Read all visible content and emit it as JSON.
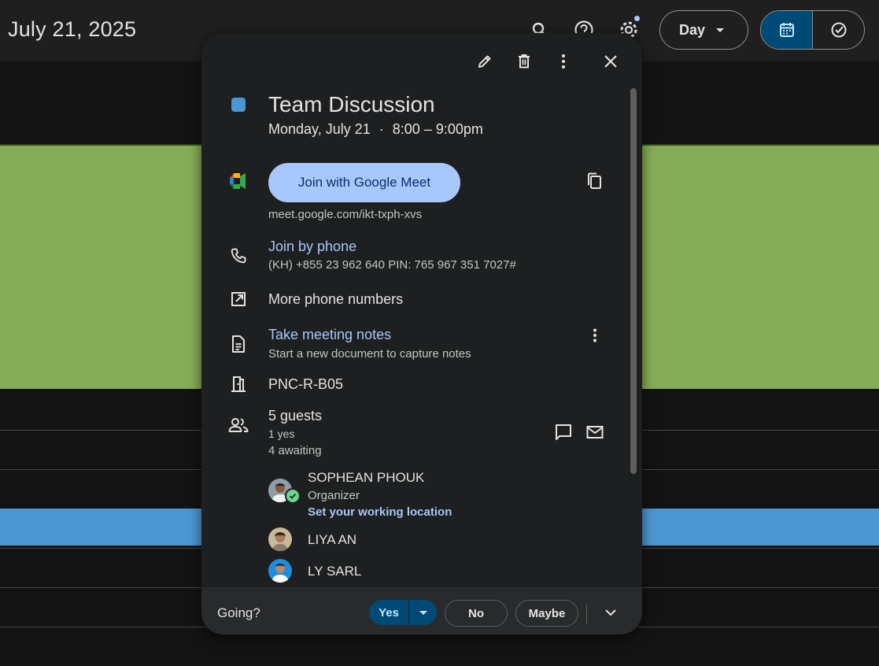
{
  "header": {
    "date_title": "July 21, 2025",
    "view_select": "Day",
    "icons": [
      "search-icon",
      "help-icon",
      "settings-icon",
      "calendar-icon",
      "tasks-icon"
    ]
  },
  "event": {
    "title": "Team Discussion",
    "date": "Monday, July 21",
    "separator": "·",
    "time": "8:00 – 9:00pm",
    "color": "#4b97d3"
  },
  "meet": {
    "button_label": "Join with Google Meet",
    "link": "meet.google.com/ikt-txph-xvs"
  },
  "phone": {
    "label": "Join by phone",
    "details": "(KH) +855 23 962 640 PIN: 765 967 351 7027#",
    "more_label": "More phone numbers"
  },
  "notes": {
    "label": "Take meeting notes",
    "description": "Start a new document to capture notes"
  },
  "room": {
    "name": "PNC-R-B05"
  },
  "guests": {
    "count_label": "5 guests",
    "yes_label": "1 yes",
    "awaiting_label": "4 awaiting",
    "list": [
      {
        "name": "SOPHEAN PHOUK",
        "role": "Organizer",
        "location_link": "Set your working location"
      },
      {
        "name": "LIYA AN"
      },
      {
        "name": "LY SARL"
      }
    ]
  },
  "rsvp": {
    "prompt": "Going?",
    "yes": "Yes",
    "no": "No",
    "maybe": "Maybe"
  },
  "colors": {
    "accent": "#a8c7fa",
    "selected": "#004a77",
    "green_event": "#85ad57",
    "blue_event": "#4b97d3"
  }
}
